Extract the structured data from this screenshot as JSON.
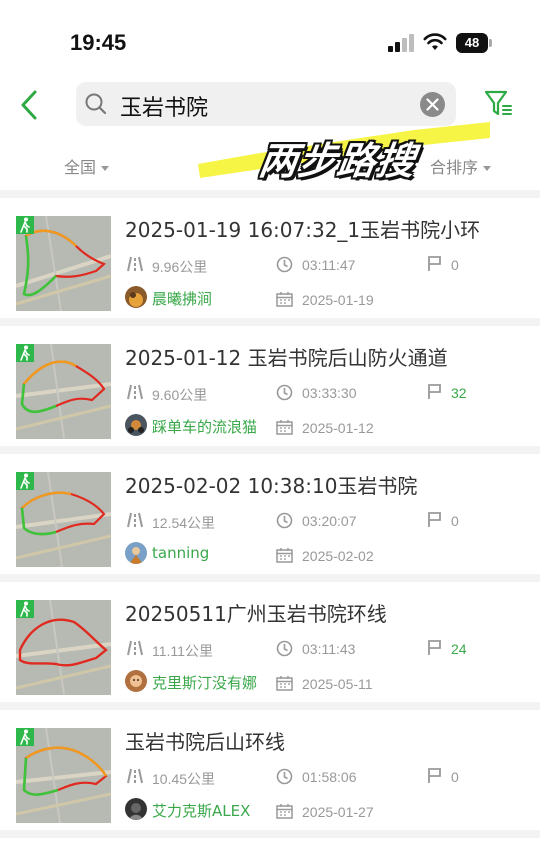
{
  "status_bar": {
    "time": "19:45",
    "battery": "48"
  },
  "search": {
    "query": "玉岩书院"
  },
  "filters": {
    "region": "全国",
    "sort": "合排序"
  },
  "overlay": {
    "text": "两步路搜"
  },
  "colors": {
    "accent": "#3aa84a",
    "highlight": "#f6f43c",
    "track_red": "#e02a1f",
    "track_orange": "#f29a1e",
    "track_green": "#3ec43b"
  },
  "icons": {
    "back": "chevron-left-icon",
    "search": "magnifier-icon",
    "clear": "clear-circle-icon",
    "filter": "funnel-filter-icon",
    "distance": "road-icon",
    "duration": "clock-icon",
    "waypoints": "flag-icon",
    "date": "calendar-icon",
    "activity": "hiking-icon"
  },
  "tracks": [
    {
      "title": "2025-01-19 16:07:32_1玉岩书院小环",
      "distance": "9.96公里",
      "duration": "03:11:47",
      "waypoints": "0",
      "user": "晨曦拂涧",
      "date": "2025-01-19"
    },
    {
      "title": "2025-01-12 玉岩书院后山防火通道",
      "distance": "9.60公里",
      "duration": "03:33:30",
      "waypoints": "32",
      "user": "踩单车的流浪猫",
      "date": "2025-01-12"
    },
    {
      "title": "2025-02-02 10:38:10玉岩书院",
      "distance": "12.54公里",
      "duration": "03:20:07",
      "waypoints": "0",
      "user": "tanning",
      "date": "2025-02-02"
    },
    {
      "title": "20250511广州玉岩书院环线",
      "distance": "11.11公里",
      "duration": "03:11:43",
      "waypoints": "24",
      "user": "克里斯汀没有娜",
      "date": "2025-05-11"
    },
    {
      "title": "玉岩书院后山环线",
      "distance": "10.45公里",
      "duration": "01:58:06",
      "waypoints": "0",
      "user": "艾力克斯ALEX",
      "date": "2025-01-27"
    }
  ]
}
